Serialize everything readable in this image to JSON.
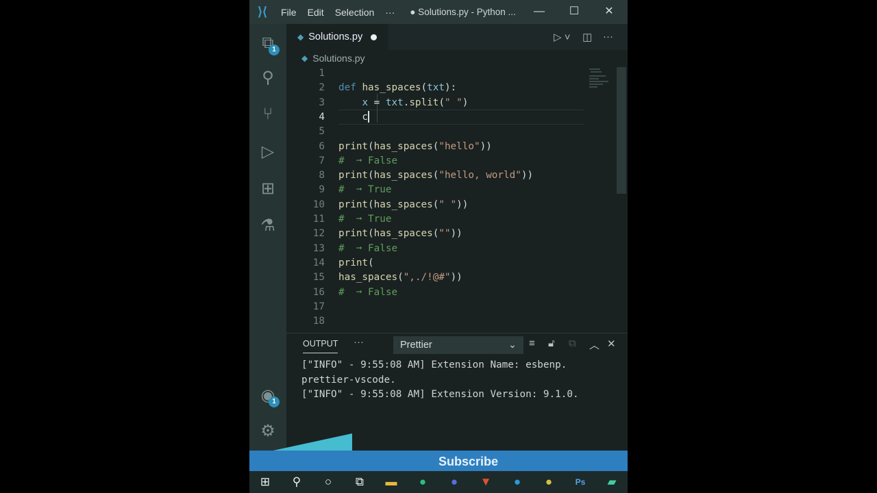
{
  "titlebar": {
    "menus": [
      "File",
      "Edit",
      "Selection",
      "···"
    ],
    "title": "● Solutions.py - Python ...",
    "minimize": "—",
    "maximize": "☐",
    "close": "✕"
  },
  "activity": {
    "explorer_badge": "1",
    "accounts_badge": "1"
  },
  "tab": {
    "label": "Solutions.py"
  },
  "breadcrumb": "Solutions.py",
  "editor": {
    "current_line": 4,
    "lines": [
      [],
      [
        [
          "kw",
          "def "
        ],
        [
          "fn",
          "has_spaces"
        ],
        [
          "pl",
          "("
        ],
        [
          "pr",
          "txt"
        ],
        [
          "pl",
          "):"
        ]
      ],
      [
        [
          "pl",
          "    "
        ],
        [
          "pr",
          "x"
        ],
        [
          "pl",
          " = "
        ],
        [
          "pr",
          "txt"
        ],
        [
          "pl",
          "."
        ],
        [
          "fn",
          "split"
        ],
        [
          "pl",
          "("
        ],
        [
          "st",
          "\" \""
        ],
        [
          "pl",
          ")"
        ]
      ],
      [
        [
          "pl",
          "    c"
        ]
      ],
      [],
      [
        [
          "fn",
          "print"
        ],
        [
          "pl",
          "("
        ],
        [
          "fn",
          "has_spaces"
        ],
        [
          "pl",
          "("
        ],
        [
          "st",
          "\"hello\""
        ],
        [
          "pl",
          "))"
        ]
      ],
      [
        [
          "cm",
          "#  ➞ False"
        ]
      ],
      [
        [
          "fn",
          "print"
        ],
        [
          "pl",
          "("
        ],
        [
          "fn",
          "has_spaces"
        ],
        [
          "pl",
          "("
        ],
        [
          "st",
          "\"hello, world\""
        ],
        [
          "pl",
          "))"
        ]
      ],
      [
        [
          "cm",
          "#  ➞ True"
        ]
      ],
      [
        [
          "fn",
          "print"
        ],
        [
          "pl",
          "("
        ],
        [
          "fn",
          "has_spaces"
        ],
        [
          "pl",
          "("
        ],
        [
          "st",
          "\" \""
        ],
        [
          "pl",
          "))"
        ]
      ],
      [
        [
          "cm",
          "#  ➞ True"
        ]
      ],
      [
        [
          "fn",
          "print"
        ],
        [
          "pl",
          "("
        ],
        [
          "fn",
          "has_spaces"
        ],
        [
          "pl",
          "("
        ],
        [
          "st",
          "\"\""
        ],
        [
          "pl",
          "))"
        ]
      ],
      [
        [
          "cm",
          "#  ➞ False"
        ]
      ],
      [
        [
          "fn",
          "print"
        ],
        [
          "pl",
          "("
        ]
      ],
      [
        [
          "fn",
          "has_spaces"
        ],
        [
          "pl",
          "("
        ],
        [
          "st",
          "\",./!@#\""
        ],
        [
          "pl",
          "))"
        ]
      ],
      [
        [
          "cm",
          "#  ➞ False"
        ]
      ],
      [],
      []
    ]
  },
  "panel": {
    "tab": "OUTPUT",
    "more": "···",
    "channel": "Prettier",
    "output": [
      "[\"INFO\" - 9:55:08 AM] Extension Name: esbenp.",
      "prettier-vscode.",
      "[\"INFO\" - 9:55:08 AM] Extension Version: 9.1.0."
    ]
  },
  "overlay": {
    "subscribe": "Subscribe"
  }
}
